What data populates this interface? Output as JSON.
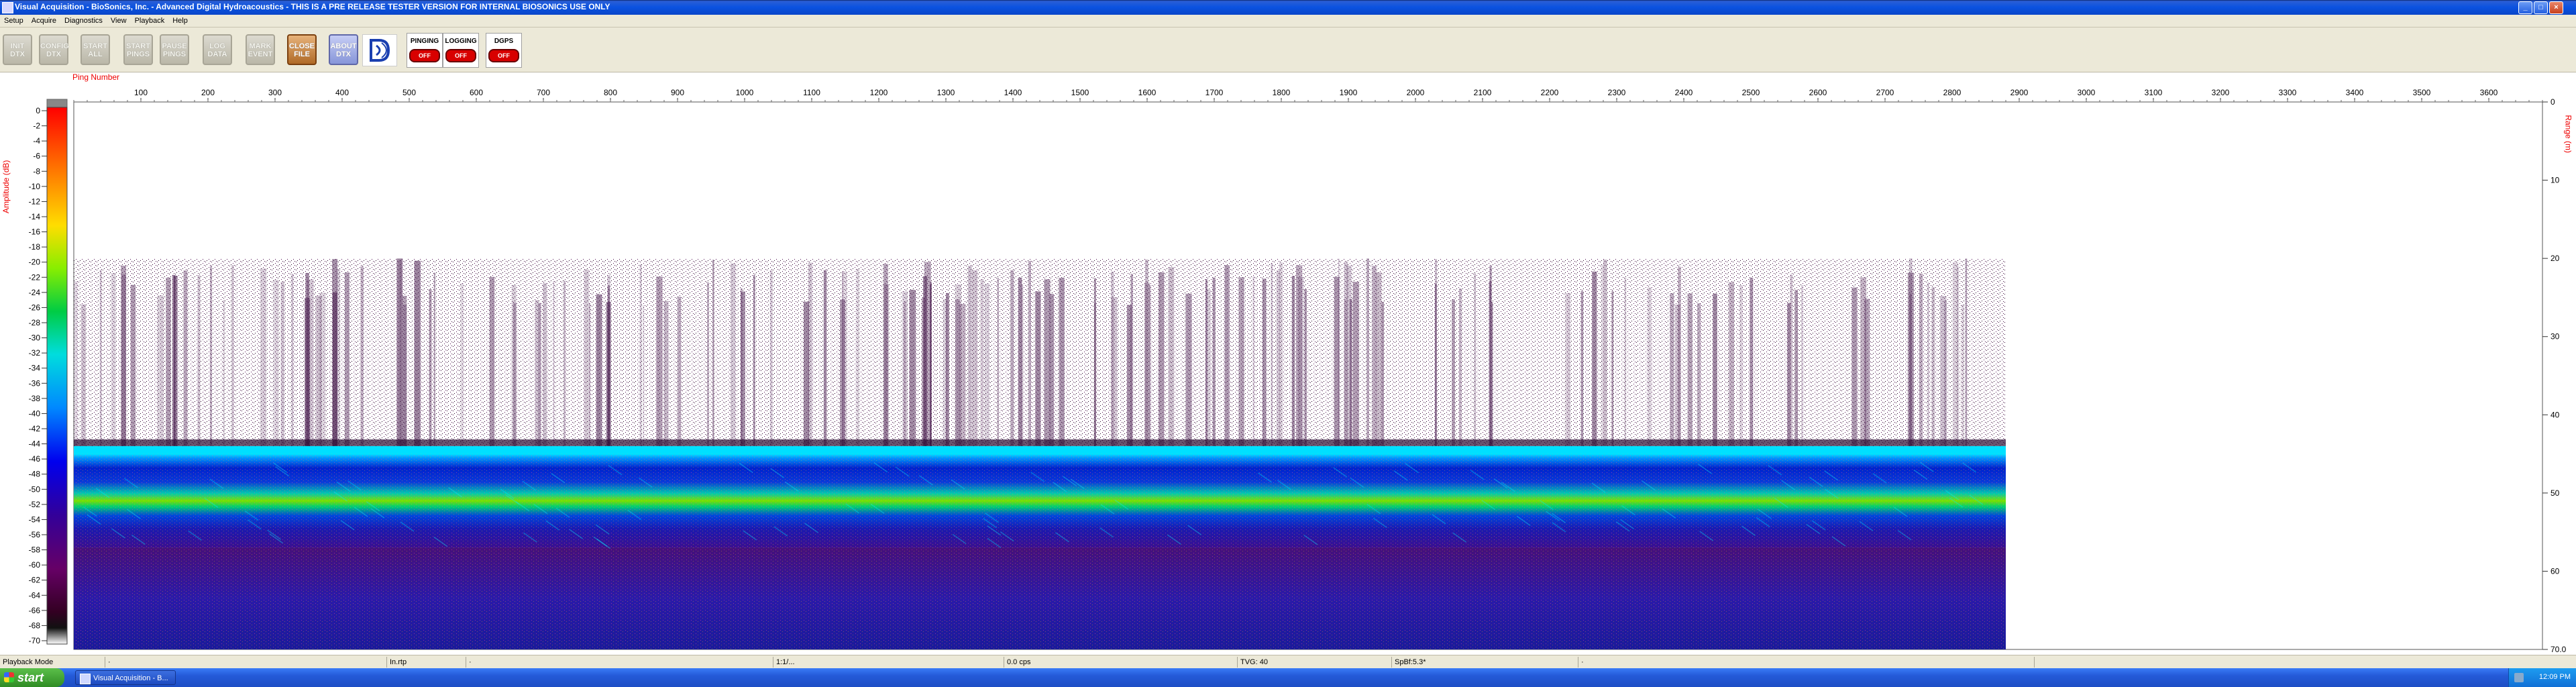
{
  "window": {
    "title": "Visual Acquisition  -  BioSonics, Inc.  -  Advanced Digital Hydroacoustics  -  THIS IS A PRE RELEASE TESTER VERSION FOR INTERNAL BIOSONICS USE ONLY",
    "minimize": "_",
    "maximize": "□",
    "close": "×"
  },
  "menu": [
    "Setup",
    "Acquire",
    "Diagnostics",
    "View",
    "Playback",
    "Help"
  ],
  "toolbar": {
    "buttons": [
      {
        "line1": "INIT",
        "line2": "DTX",
        "style": "grey"
      },
      {
        "line1": "CONFIG",
        "line2": "DTX",
        "style": "grey"
      },
      {
        "line1": "START",
        "line2": "ALL",
        "style": "grey"
      },
      {
        "line1": "START",
        "line2": "PINGS",
        "style": "grey"
      },
      {
        "line1": "PAUSE",
        "line2": "PINGS",
        "style": "grey"
      },
      {
        "line1": "LOG",
        "line2": "DATA",
        "style": "grey"
      },
      {
        "line1": "MARK",
        "line2": "EVENT",
        "style": "grey"
      },
      {
        "line1": "CLOSE",
        "line2": "FILE",
        "style": "orange"
      },
      {
        "line1": "ABOUT",
        "line2": "DTX",
        "style": "blue"
      }
    ],
    "indicators": [
      {
        "label": "PINGING",
        "state": "OFF"
      },
      {
        "label": "LOGGING",
        "state": "OFF"
      },
      {
        "label": "DGPS",
        "state": "OFF"
      }
    ]
  },
  "chart": {
    "x_axis_title": "Ping Number",
    "left_axis_title": "Amplitude (dB)",
    "right_axis_title": "Range (m)",
    "x_ticks": [
      100,
      200,
      300,
      400,
      500,
      600,
      700,
      800,
      900,
      1000,
      1100,
      1200,
      1300,
      1400,
      1500,
      1600,
      1700,
      1800,
      1900,
      2000,
      2100,
      2200,
      2300,
      2400,
      2500,
      2600,
      2700,
      2800,
      2900,
      3000,
      3100,
      3200,
      3300,
      3400,
      3500,
      3600
    ],
    "amp_ticks": [
      0,
      -2,
      -4,
      -6,
      -8,
      -10,
      -12,
      -14,
      -16,
      -18,
      -20,
      -22,
      -24,
      -26,
      -28,
      -30,
      -32,
      -34,
      -36,
      -38,
      -40,
      -42,
      -44,
      -46,
      -48,
      -50,
      -52,
      -54,
      -56,
      -58,
      -60,
      -62,
      -64,
      -66,
      -68,
      -70
    ],
    "range_ticks": [
      "0",
      "10",
      "20",
      "30",
      "40",
      "50",
      "60",
      "70.0"
    ]
  },
  "chart_data": {
    "type": "heatmap",
    "x_label": "Ping Number",
    "y_label": "Range (m)",
    "xlim": [
      0,
      3680
    ],
    "range_lim": [
      0,
      70
    ],
    "amplitude_lim": [
      0,
      -70
    ],
    "pings_recorded": 2880,
    "bands": [
      {
        "range_m": [
          20,
          44
        ],
        "description": "sparse dark-purple scatter"
      },
      {
        "range_m": [
          44,
          45
        ],
        "description": "bright cyan bottom line"
      },
      {
        "range_m": [
          45,
          57
        ],
        "description": "blue layer with green/yellow band near 52 m"
      },
      {
        "range_m": [
          57,
          70
        ],
        "description": "purple/blue noise"
      }
    ]
  },
  "status": [
    {
      "text": "Playback Mode"
    },
    {
      "text": "·"
    },
    {
      "text": "In.rtp"
    },
    {
      "text": "·"
    },
    {
      "text": "1:1/..."
    },
    {
      "text": "0.0 cps"
    },
    {
      "text": "TVG: 40"
    },
    {
      "text": "SpBf:5.3*"
    },
    {
      "text": "·"
    }
  ],
  "taskbar": {
    "start": "start",
    "item": "Visual Acquisition  -  B...",
    "clock": "12:09 PM"
  }
}
